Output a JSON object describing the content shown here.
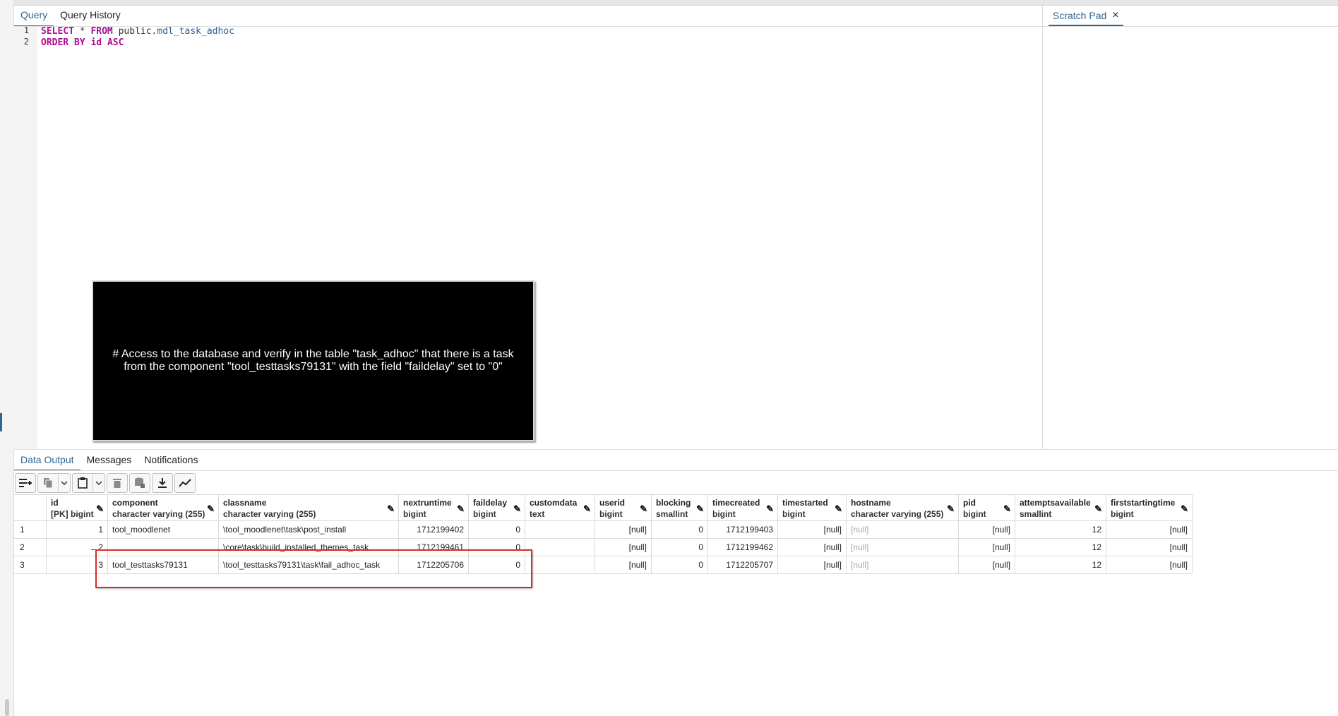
{
  "query_tabs": [
    {
      "label": "Query",
      "active": true
    },
    {
      "label": "Query History",
      "active": false
    }
  ],
  "scratch_pad": {
    "label": "Scratch Pad",
    "close_icon": "×"
  },
  "editor": {
    "lines": [
      {
        "num": "1",
        "tokens": [
          "SELECT",
          " * ",
          "FROM",
          " public.",
          "mdl_task_adhoc"
        ]
      },
      {
        "num": "2",
        "tokens": [
          "ORDER",
          " ",
          "BY",
          " ",
          "id",
          " ",
          "ASC"
        ]
      }
    ]
  },
  "overlay": {
    "text": "# Access to the database and verify in the table \"task_adhoc\" that there is a task from the component \"tool_testtasks79131\" with the field \"faildelay\" set to \"0\""
  },
  "output_tabs": [
    {
      "label": "Data Output",
      "active": true
    },
    {
      "label": "Messages",
      "active": false
    },
    {
      "label": "Notifications",
      "active": false
    }
  ],
  "toolbar": {
    "icons": [
      "add-row-icon",
      "copy-icon",
      "dropdown-icon",
      "paste-icon",
      "dropdown-icon",
      "delete-icon",
      "save-data-icon",
      "download-icon",
      "graph-icon"
    ]
  },
  "columns": [
    {
      "name": "id",
      "type": "[PK] bigint"
    },
    {
      "name": "component",
      "type": "character varying (255)"
    },
    {
      "name": "classname",
      "type": "character varying (255)"
    },
    {
      "name": "nextruntime",
      "type": "bigint"
    },
    {
      "name": "faildelay",
      "type": "bigint"
    },
    {
      "name": "customdata",
      "type": "text"
    },
    {
      "name": "userid",
      "type": "bigint"
    },
    {
      "name": "blocking",
      "type": "smallint"
    },
    {
      "name": "timecreated",
      "type": "bigint"
    },
    {
      "name": "timestarted",
      "type": "bigint"
    },
    {
      "name": "hostname",
      "type": "character varying (255)"
    },
    {
      "name": "pid",
      "type": "bigint"
    },
    {
      "name": "attemptsavailable",
      "type": "smallint"
    },
    {
      "name": "firststartingtime",
      "type": "bigint"
    }
  ],
  "rows": [
    {
      "row": "1",
      "cells": [
        "1",
        "tool_moodlenet",
        "\\tool_moodlenet\\task\\post_install",
        "1712199402",
        "0",
        "",
        "[null]",
        "0",
        "1712199403",
        "[null]",
        "[null]",
        "[null]",
        "12",
        "[null]"
      ]
    },
    {
      "row": "2",
      "cells": [
        "2",
        "",
        "\\core\\task\\build_installed_themes_task",
        "1712199461",
        "0",
        "",
        "[null]",
        "0",
        "1712199462",
        "[null]",
        "[null]",
        "[null]",
        "12",
        "[null]"
      ]
    },
    {
      "row": "3",
      "cells": [
        "3",
        "tool_testtasks79131",
        "\\tool_testtasks79131\\task\\fail_adhoc_task",
        "1712205706",
        "0",
        "",
        "[null]",
        "0",
        "1712205707",
        "[null]",
        "[null]",
        "[null]",
        "12",
        "[null]"
      ]
    }
  ],
  "colors": {
    "accent": "#326690",
    "highlight": "#d92b2b",
    "keyword": "#a90d91"
  }
}
